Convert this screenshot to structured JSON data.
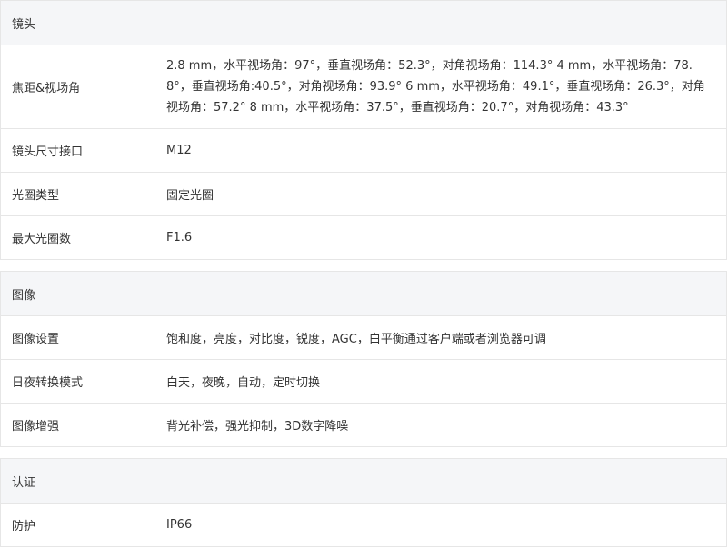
{
  "sections": [
    {
      "title": "镜头",
      "rows": [
        {
          "label": "焦距&视场角",
          "value": "2.8 mm，水平视场角：97°，垂直视场角：52.3°，对角视场角：114.3° 4 mm，水平视场角：78.8°，垂直视场角:40.5°，对角视场角：93.9° 6 mm，水平视场角：49.1°，垂直视场角：26.3°，对角视场角：57.2° 8 mm，水平视场角：37.5°，垂直视场角：20.7°，对角视场角：43.3°"
        },
        {
          "label": "镜头尺寸接口",
          "value": "M12"
        },
        {
          "label": "光圈类型",
          "value": "固定光圈"
        },
        {
          "label": "最大光圈数",
          "value": "F1.6"
        }
      ]
    },
    {
      "title": "图像",
      "rows": [
        {
          "label": "图像设置",
          "value": "饱和度，亮度，对比度，锐度，AGC，白平衡通过客户端或者浏览器可调"
        },
        {
          "label": "日夜转换模式",
          "value": "白天，夜晚，自动，定时切换"
        },
        {
          "label": "图像增强",
          "value": "背光补偿，强光抑制，3D数字降噪"
        }
      ]
    },
    {
      "title": "认证",
      "rows": [
        {
          "label": "防护",
          "value": "IP66"
        }
      ]
    }
  ]
}
